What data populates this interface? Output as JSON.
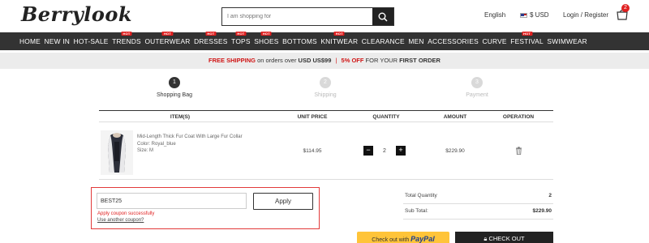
{
  "header": {
    "logo": "Berrylook",
    "search_placeholder": "I am shopping for",
    "language": "English",
    "currency": "$ USD",
    "login": "Login / Register",
    "cart_count": "2"
  },
  "nav": {
    "items": [
      {
        "label": "HOME",
        "hot": false
      },
      {
        "label": "NEW IN",
        "hot": false
      },
      {
        "label": "HOT-SALE",
        "hot": false
      },
      {
        "label": "TRENDS",
        "hot": true
      },
      {
        "label": "OUTERWEAR",
        "hot": true
      },
      {
        "label": "DRESSES",
        "hot": true
      },
      {
        "label": "TOPS",
        "hot": true
      },
      {
        "label": "SHOES",
        "hot": true
      },
      {
        "label": "BOTTOMS",
        "hot": false
      },
      {
        "label": "KNITWEAR",
        "hot": true
      },
      {
        "label": "CLEARANCE",
        "hot": false
      },
      {
        "label": "MEN",
        "hot": false
      },
      {
        "label": "ACCESSORIES",
        "hot": false
      },
      {
        "label": "CURVE",
        "hot": false
      },
      {
        "label": "FESTIVAL",
        "hot": true
      },
      {
        "label": "SWIMWEAR",
        "hot": false
      }
    ],
    "hot_label": "HOT"
  },
  "promo": {
    "free_shipping": "FREE SHIPPING",
    "on_orders": "on orders over",
    "threshold": "USD US$99",
    "separator": "|",
    "discount": "5% OFF",
    "for_your": "FOR YOUR",
    "first_order": "FIRST ORDER"
  },
  "steps": [
    {
      "number": "1",
      "label": "Shopping Bag"
    },
    {
      "number": "2",
      "label": "Shipping"
    },
    {
      "number": "3",
      "label": "Payment"
    }
  ],
  "table": {
    "headers": [
      "ITEM(S)",
      "UNIT PRICE",
      "QUANTITY",
      "AMOUNT",
      "OPERATION"
    ],
    "item": {
      "name": "Mid-Length Thick Fur Coat With Large Fur Collar",
      "color": "Color: Royal_blue",
      "size": "Size: M",
      "unit_price": "$114.95",
      "quantity": "2",
      "amount": "$229.90"
    }
  },
  "coupon": {
    "code": "BEST25",
    "apply_label": "Apply",
    "success_message": "Apply coupon successfully",
    "other_link": "Use another coupon?"
  },
  "summary": {
    "total_quantity_label": "Total Quantity",
    "total_quantity": "2",
    "subtotal_label": "Sub Total:",
    "subtotal": "$229.90"
  },
  "buttons": {
    "paypal_prefix": "Check out with",
    "paypal_brand": "PayPal",
    "checkout": "CHECK OUT"
  },
  "colors": {
    "accent_red": "#d01414",
    "nav_bg": "#333333",
    "hot_badge": "#e02020",
    "paypal_yellow": "#ffc439"
  }
}
